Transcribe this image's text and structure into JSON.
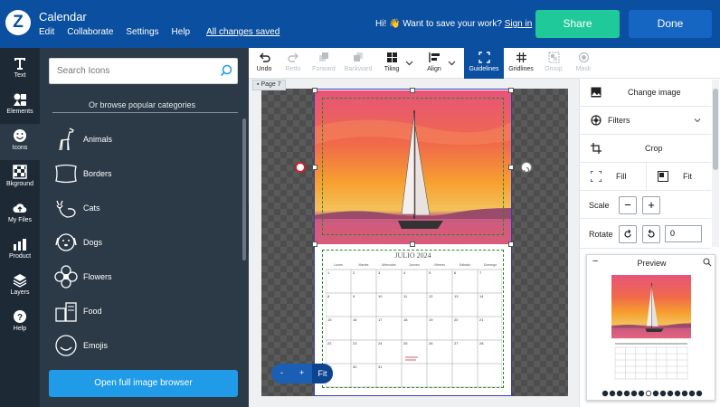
{
  "header": {
    "app_title": "Calendar",
    "menu": [
      "Edit",
      "Collaborate",
      "Settings",
      "Help"
    ],
    "save_status": "All changes saved",
    "save_prompt_text": "Hi! 👋 Want to save your work?",
    "sign_in_label": "Sign in",
    "share_label": "Share",
    "done_label": "Done"
  },
  "rail": [
    {
      "label": "Text",
      "icon": "text-icon"
    },
    {
      "label": "Elements",
      "icon": "elements-icon"
    },
    {
      "label": "Icons",
      "icon": "smiley-icon"
    },
    {
      "label": "Bkground",
      "icon": "background-icon"
    },
    {
      "label": "My Files",
      "icon": "cloud-upload-icon"
    },
    {
      "label": "Product",
      "icon": "product-icon"
    },
    {
      "label": "Layers",
      "icon": "layers-icon"
    },
    {
      "label": "Help",
      "icon": "help-icon"
    }
  ],
  "panel": {
    "search_placeholder": "Search Icons",
    "browse_label": "Or browse popular categories",
    "categories": [
      "Animals",
      "Borders",
      "Cats",
      "Dogs",
      "Flowers",
      "Food",
      "Emojis"
    ],
    "open_browser_label": "Open full image browser"
  },
  "toolbar": {
    "tools": [
      {
        "label": "Undo",
        "state": "enabled"
      },
      {
        "label": "Redo",
        "state": "disabled"
      },
      {
        "label": "Forward",
        "state": "disabled"
      },
      {
        "label": "Backward",
        "state": "disabled"
      },
      {
        "label": "Tiling",
        "state": "enabled"
      },
      {
        "label": "Align",
        "state": "enabled"
      },
      {
        "label": "Guidelines",
        "state": "active"
      },
      {
        "label": "Gridlines",
        "state": "enabled"
      },
      {
        "label": "Group",
        "state": "disabled"
      },
      {
        "label": "Mask",
        "state": "disabled"
      }
    ]
  },
  "canvas": {
    "page_label": "Page 7",
    "calendar_title": "JULIO 2024",
    "weekdays": [
      "Lunes",
      "Martes",
      "Miércoles",
      "Jueves",
      "Viernes",
      "Sábado",
      "Domingo"
    ],
    "zoom_minus": "-",
    "zoom_plus": "+",
    "zoom_fit": "Fit"
  },
  "right_panel": {
    "change_image": "Change image",
    "filters": "Filters",
    "crop": "Crop",
    "fill": "Fill",
    "fit": "Fit",
    "scale_label": "Scale",
    "scale_minus": "−",
    "scale_plus": "+",
    "rotate_label": "Rotate",
    "rotate_value": "0"
  },
  "preview": {
    "title": "Preview",
    "collapse": "−",
    "page_count": 14,
    "current_page": 7
  },
  "colors": {
    "header_blue": "#0b4fa0",
    "share_green": "#1fc99a",
    "panel_dark": "#2c3a47",
    "guide_green": "#1c8a2a",
    "accent_blue": "#1f9be8"
  }
}
